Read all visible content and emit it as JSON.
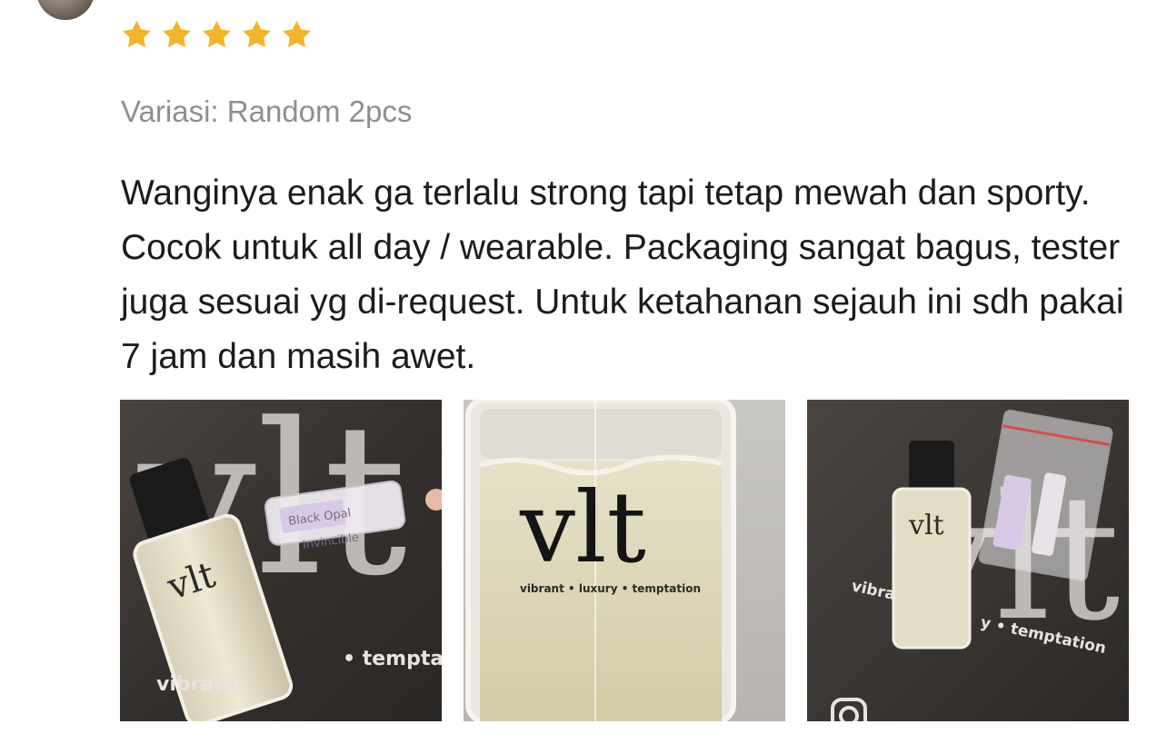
{
  "review": {
    "rating": 5,
    "rating_max": 5,
    "star_color": "#F5B52A",
    "variation": "Variasi: Random 2pcs",
    "text": "Wanginya enak ga terlalu strong tapi tetap mewah dan sporty. Cocok untuk all day / wearable. Packaging sangat bagus, tester juga sesuai yg di-request. Untuk ketahanan sejauh ini sdh pakai 7 jam dan masih awet."
  },
  "photos": [
    {
      "description_icon": "perfume-bottle-photo",
      "brand": "vlt",
      "tagline_fragment": "vibrant",
      "tagline_end": "• tempta",
      "tester_label_1": "Black Opal",
      "tester_label_2": "Invincible"
    },
    {
      "description_icon": "perfume-closeup-photo",
      "brand": "vlt",
      "tagline": "vibrant • luxury • temptation"
    },
    {
      "description_icon": "perfume-with-testers-photo",
      "brand": "vlt",
      "tagline_fragment": "vibra",
      "tagline_end": "y • temptation"
    }
  ]
}
